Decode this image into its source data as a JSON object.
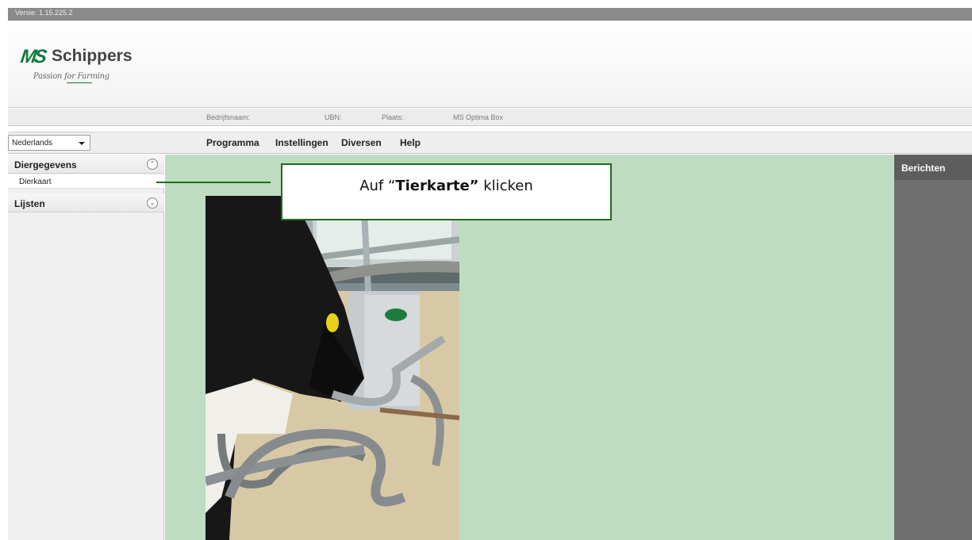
{
  "app": {
    "version": "Versie: 1.15.225.2"
  },
  "logo": {
    "mark": "MS",
    "name": "Schippers",
    "tagline_part1": "Passion",
    "tagline_part2": "for",
    "tagline_part3": "Farming"
  },
  "info_bar": {
    "company_label": "Bedrijfsnaam:",
    "ubn_label": "UBN:",
    "place_label": "Plaats:",
    "product": "MS Optima Box"
  },
  "language": {
    "selected": "Nederlands"
  },
  "menu": {
    "items": [
      "Programma",
      "Instellingen",
      "Diversen",
      "Help"
    ]
  },
  "sidebar": {
    "sections": [
      {
        "title": "Diergegevens",
        "expanded": true,
        "items": [
          "Dierkaart"
        ]
      },
      {
        "title": "Lijsten",
        "expanded": false,
        "items": []
      }
    ]
  },
  "callout": {
    "prefix": "Auf “",
    "bold": "Tierkarte”",
    "suffix": " klicken"
  },
  "right_panel": {
    "title": "Berichten"
  },
  "colors": {
    "main_bg": "#bedcbf",
    "accent": "#1e6b1e",
    "brand_green": "#0f7a3e",
    "right_panel_bg": "#6e6e6e"
  }
}
